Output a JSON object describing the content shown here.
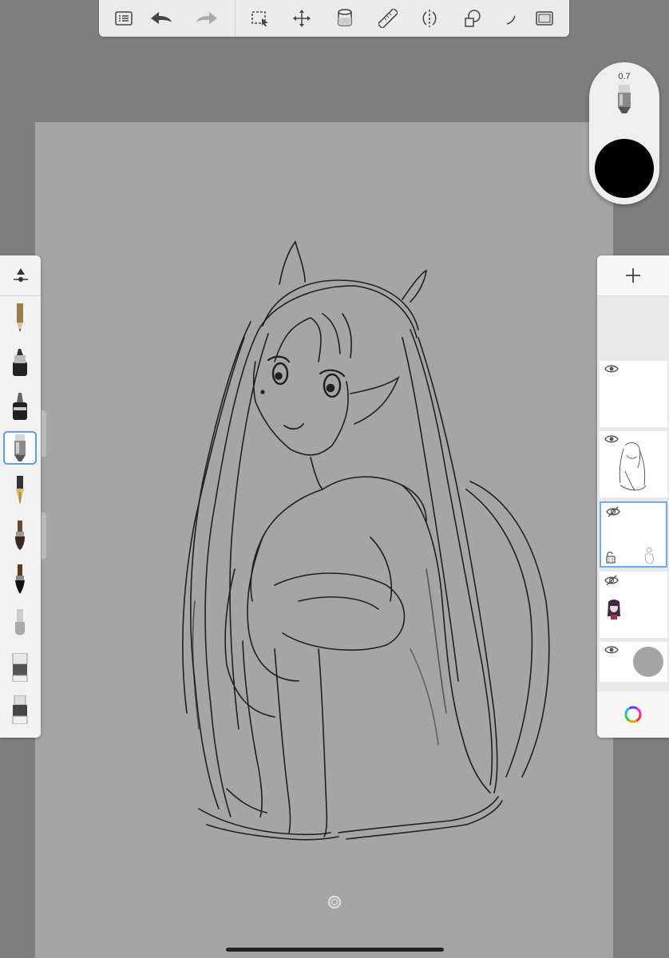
{
  "app": {
    "toolbar": {
      "tools": [
        {
          "name": "gallery-list"
        },
        {
          "name": "undo"
        },
        {
          "name": "redo"
        },
        {
          "name": "selection"
        },
        {
          "name": "transform"
        },
        {
          "name": "fill"
        },
        {
          "name": "ruler"
        },
        {
          "name": "symmetry"
        },
        {
          "name": "shapes"
        },
        {
          "name": "perspective"
        },
        {
          "name": "fullscreen"
        }
      ]
    },
    "brush_puck": {
      "size_label": "0.7",
      "color": "#000000"
    },
    "brushes": [
      {
        "name": "pencil",
        "selected": false
      },
      {
        "name": "marker",
        "selected": false
      },
      {
        "name": "airbrush",
        "selected": false
      },
      {
        "name": "ballpoint-pen",
        "selected": true
      },
      {
        "name": "fountain-pen",
        "selected": false
      },
      {
        "name": "paintbrush",
        "selected": false
      },
      {
        "name": "ink-brush",
        "selected": false
      },
      {
        "name": "smudge",
        "selected": false
      },
      {
        "name": "soft-eraser",
        "selected": false
      },
      {
        "name": "hard-eraser",
        "selected": false
      }
    ],
    "layers": [
      {
        "name": "empty-layer",
        "visible": true,
        "selected": false
      },
      {
        "name": "sketch-layer",
        "visible": true,
        "selected": false
      },
      {
        "name": "hidden-layer",
        "visible": false,
        "selected": true
      },
      {
        "name": "reference-layer",
        "visible": false,
        "selected": false
      },
      {
        "name": "background-layer",
        "visible": true,
        "selected": false
      }
    ],
    "colors": {
      "canvas": "#a5a5a5",
      "background": "#7f7f7f",
      "accent": "#5aa0e6"
    }
  }
}
